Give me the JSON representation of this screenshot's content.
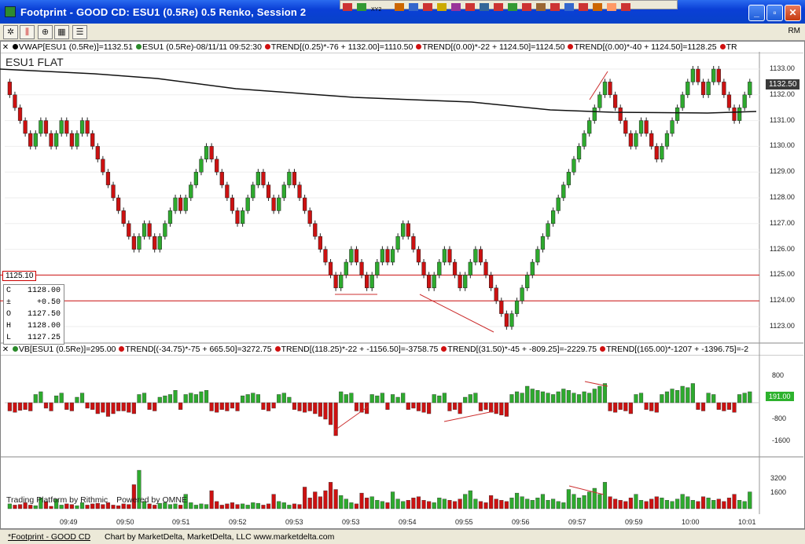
{
  "window": {
    "title": "Footprint - GOOD CD: ESU1 (0.5Re) 0.5 Renko, Session 2",
    "buttons": [
      "minimize",
      "maximize",
      "close"
    ]
  },
  "toolbar": {
    "icons": [
      "gear-icon",
      "bars-icon",
      "zoom-icon",
      "grid-icon",
      "table-icon"
    ],
    "rm_label": "RM"
  },
  "floating_toolbar": {
    "label": "XY2"
  },
  "legends": {
    "price": [
      {
        "text": "VWAP[ESU1 (0.5Re)]=1132.51",
        "color": "#000000"
      },
      {
        "text": "ESU1 (0.5Re)-08/11/11 09:52:30",
        "color": "#2a8a2a"
      },
      {
        "text": "TREND[(0.25)*-76 + 1132.00]=1110.50",
        "color": "#d01010"
      },
      {
        "text": "TREND[(0.00)*-22 + 1124.50]=1124.50",
        "color": "#d01010"
      },
      {
        "text": "TREND[(0.00)*-40 + 1124.50]=1128.25",
        "color": "#d01010"
      },
      {
        "text": "TR",
        "color": "#d01010"
      }
    ],
    "vb": [
      {
        "text": "VB[ESU1 (0.5Re)]=295.00",
        "color": "#2a8a2a"
      },
      {
        "text": "TREND[(-34.75)*-75 + 665.50]=3272.75",
        "color": "#d01010"
      },
      {
        "text": "TREND[(118.25)*-22 + -1156.50]=-3758.75",
        "color": "#d01010"
      },
      {
        "text": "TREND[(31.50)*-45 + -809.25]=-2229.75",
        "color": "#d01010"
      },
      {
        "text": "TREND[(165.00)*-1207 + -1396.75]=-2",
        "color": "#d01010"
      }
    ]
  },
  "chart_title": "ESU1 FLAT",
  "ohlc": [
    {
      "label": "C",
      "value": "1128.00"
    },
    {
      "label": "±",
      "value": "+0.50"
    },
    {
      "label": "O",
      "value": "1127.50"
    },
    {
      "label": "H",
      "value": "1128.00"
    },
    {
      "label": "L",
      "value": "1127.25"
    }
  ],
  "price_tag": "1125.10",
  "last_price_tag": "1132.50",
  "vb_tag": "191.00",
  "price_axis": [
    "1133.00",
    "1132.00",
    "1131.00",
    "1130.00",
    "1129.00",
    "1128.00",
    "1127.00",
    "1126.00",
    "1125.00",
    "1124.00",
    "1123.00"
  ],
  "vb_axis": [
    "800",
    "-800",
    "-1600"
  ],
  "vol_axis": [
    "3200",
    "1600"
  ],
  "time_axis": [
    "09:49",
    "09:50",
    "09:51",
    "09:52",
    "09:53",
    "09:53",
    "09:54",
    "09:55",
    "09:56",
    "09:57",
    "09:59",
    "10:00",
    "10:01"
  ],
  "branding": {
    "rithmic": "Trading Platform by Rithmic",
    "omne": "Powered by OMNE"
  },
  "status": {
    "left": "*Footprint - GOOD CD",
    "right": "Chart by MarketDelta, MarketDelta, LLC www.marketdelta.com"
  },
  "chart_data": {
    "type": "candlestick",
    "instrument": "ESU1 (0.5Re) 0.5 Renko",
    "ylim": [
      1122.75,
      1133.5
    ],
    "horizontal_lines": [
      1125.0,
      1124.0
    ],
    "renko_brick_size": 0.5,
    "closes": [
      1132.0,
      1131.5,
      1131.0,
      1130.5,
      1130.0,
      1130.5,
      1131.0,
      1130.5,
      1130.0,
      1130.5,
      1131.0,
      1130.5,
      1130.0,
      1130.5,
      1131.0,
      1130.5,
      1130.0,
      1129.5,
      1129.0,
      1128.5,
      1128.0,
      1127.5,
      1127.0,
      1126.5,
      1126.0,
      1126.5,
      1127.0,
      1126.5,
      1126.0,
      1126.5,
      1127.0,
      1127.5,
      1128.0,
      1127.5,
      1128.0,
      1128.5,
      1129.0,
      1129.5,
      1130.0,
      1129.5,
      1129.0,
      1128.5,
      1128.0,
      1127.5,
      1127.0,
      1127.5,
      1128.0,
      1128.5,
      1129.0,
      1128.5,
      1128.0,
      1127.5,
      1128.0,
      1128.5,
      1129.0,
      1128.5,
      1128.0,
      1127.5,
      1127.0,
      1126.5,
      1126.0,
      1125.5,
      1125.0,
      1124.5,
      1125.0,
      1125.5,
      1126.0,
      1125.5,
      1125.0,
      1124.5,
      1125.0,
      1125.5,
      1126.0,
      1125.5,
      1126.0,
      1126.5,
      1127.0,
      1126.5,
      1126.0,
      1125.5,
      1125.0,
      1124.5,
      1125.0,
      1125.5,
      1126.0,
      1125.5,
      1125.0,
      1124.5,
      1125.0,
      1125.5,
      1126.0,
      1125.5,
      1125.0,
      1124.5,
      1124.0,
      1123.5,
      1123.0,
      1123.5,
      1124.0,
      1124.5,
      1125.0,
      1125.5,
      1126.0,
      1126.5,
      1127.0,
      1127.5,
      1128.0,
      1128.5,
      1129.0,
      1129.5,
      1130.0,
      1130.5,
      1131.0,
      1131.5,
      1132.0,
      1132.5,
      1132.0,
      1131.5,
      1131.0,
      1130.5,
      1130.0,
      1130.5,
      1131.0,
      1130.5,
      1130.0,
      1129.5,
      1130.0,
      1130.5,
      1131.0,
      1131.5,
      1132.0,
      1132.5,
      1133.0,
      1132.5,
      1132.0,
      1132.5,
      1133.0,
      1132.5,
      1132.0,
      1131.5,
      1131.0,
      1131.5,
      1132.0,
      1132.5
    ],
    "vb": [
      -300,
      -350,
      -280,
      -250,
      -300,
      300,
      400,
      -200,
      -300,
      250,
      350,
      -250,
      -300,
      200,
      350,
      -200,
      -250,
      -400,
      -350,
      -500,
      -400,
      -300,
      -300,
      -350,
      -400,
      300,
      350,
      -250,
      -300,
      200,
      250,
      300,
      450,
      -250,
      300,
      350,
      300,
      400,
      450,
      -300,
      -350,
      -250,
      -300,
      -200,
      -300,
      250,
      300,
      350,
      300,
      -250,
      -300,
      -200,
      300,
      350,
      200,
      -250,
      -300,
      -350,
      -300,
      -400,
      -500,
      -600,
      -800,
      -1200,
      400,
      300,
      350,
      -300,
      -350,
      -400,
      300,
      250,
      350,
      -250,
      300,
      200,
      350,
      -250,
      -200,
      -300,
      -350,
      -400,
      300,
      250,
      350,
      -300,
      -250,
      -400,
      200,
      300,
      350,
      -300,
      -250,
      -350,
      -400,
      -450,
      -500,
      300,
      400,
      350,
      600,
      500,
      450,
      400,
      350,
      300,
      400,
      500,
      450,
      350,
      300,
      400,
      350,
      500,
      600,
      700,
      -300,
      -350,
      -250,
      -300,
      -400,
      300,
      350,
      -250,
      -300,
      -350,
      300,
      400,
      500,
      450,
      600,
      550,
      700,
      -250,
      -300,
      350,
      300,
      -250,
      -300,
      -250,
      -350,
      300,
      350,
      400
    ],
    "volume": [
      400,
      300,
      350,
      500,
      300,
      250,
      900,
      600,
      200,
      800,
      300,
      400,
      350,
      250,
      500,
      300,
      400,
      450,
      350,
      500,
      300,
      250,
      400,
      350,
      2000,
      3200,
      600,
      400,
      300,
      450,
      500,
      350,
      400,
      300,
      1200,
      500,
      300,
      400,
      350,
      1500,
      600,
      300,
      400,
      500,
      350,
      400,
      300,
      500,
      450,
      300,
      400,
      1200,
      600,
      500,
      300,
      400,
      350,
      1800,
      900,
      1400,
      1000,
      1500,
      2200,
      1600,
      1100,
      800,
      500,
      400,
      1300,
      900,
      1000,
      700,
      600,
      500,
      1400,
      800,
      600,
      700,
      900,
      1000,
      700,
      600,
      500,
      900,
      800,
      700,
      600,
      800,
      1200,
      1500,
      800,
      600,
      500,
      1100,
      800,
      700,
      600,
      900,
      1300,
      1000,
      800,
      700,
      900,
      1200,
      700,
      800,
      600,
      500,
      1600,
      1200,
      900,
      1100,
      1400,
      1700,
      1200,
      2200,
      1000,
      800,
      700,
      600,
      900,
      1200,
      700,
      600,
      800,
      1000,
      900,
      700,
      600,
      800,
      1200,
      1000,
      700,
      600,
      1000,
      900,
      700,
      800,
      600,
      900,
      1200,
      700,
      600,
      1400
    ]
  },
  "colors": {
    "up": "#2eaa2e",
    "down": "#cc1111",
    "vwap": "#111111",
    "level_line": "#cc1111",
    "trend_line": "#cc3030"
  }
}
